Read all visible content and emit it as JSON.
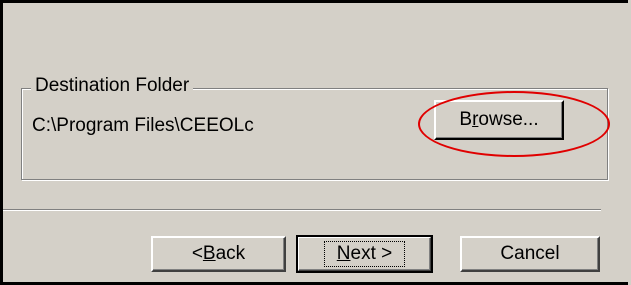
{
  "dialog": {
    "destination_group_label": "Destination Folder",
    "destination_path": "C:\\Program Files\\CEEOLc",
    "browse_button": {
      "pre": "B",
      "accel": "r",
      "post": "owse..."
    },
    "back_button": {
      "pre": "< ",
      "accel": "B",
      "post": "ack"
    },
    "next_button": {
      "pre": "",
      "accel": "N",
      "post": "ext >"
    },
    "cancel_button": "Cancel"
  },
  "annotation": {
    "highlight_color": "#e00000"
  }
}
